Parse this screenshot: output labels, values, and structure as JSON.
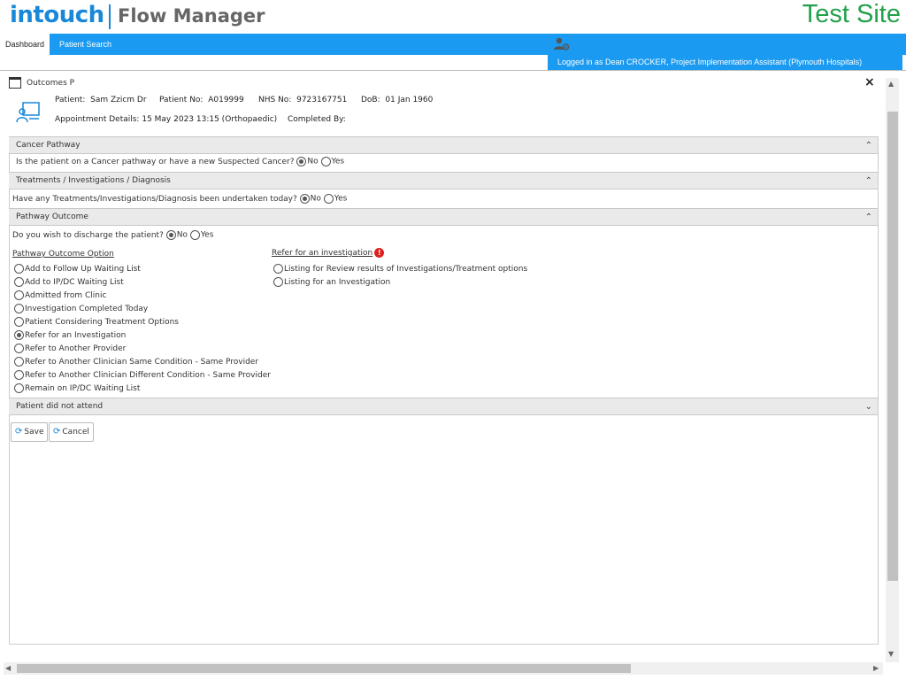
{
  "header": {
    "brand": "intouch",
    "product": "Flow Manager",
    "environment": "Test Site"
  },
  "nav": {
    "tabs": [
      "Dashboard",
      "Patient Search"
    ],
    "login_text": "Logged in as Dean CROCKER, Project Implementation Assistant (Plymouth Hospitals)"
  },
  "window": {
    "title": "Outcomes P",
    "close": "×"
  },
  "patient": {
    "patient_label": "Patient:",
    "patient_name": "Sam Zzicm Dr",
    "patient_no_label": "Patient No:",
    "patient_no": "A019999",
    "nhs_label": "NHS No:",
    "nhs_no": "9723167751",
    "dob_label": "DoB:",
    "dob": "01 Jan 1960",
    "appt_label": "Appointment Details:",
    "appt": "15 May 2023 13:15 (Orthopaedic)",
    "completed_label": "Completed By:"
  },
  "sections": {
    "cancer": {
      "title": "Cancer Pathway",
      "question": "Is the patient on a Cancer pathway or have a new Suspected Cancer?",
      "selected": "No"
    },
    "treatments": {
      "title": "Treatments / Investigations / Diagnosis",
      "question": "Have any Treatments/Investigations/Diagnosis been undertaken today?",
      "selected": "No"
    },
    "pathway": {
      "title": "Pathway Outcome",
      "question": "Do you wish to discharge the patient?",
      "selected": "No",
      "options_header": "Pathway Outcome Option",
      "options": [
        "Add to Follow Up Waiting List",
        "Add to IP/DC Waiting List",
        "Admitted from Clinic",
        "Investigation Completed Today",
        "Patient Considering Treatment Options",
        "Refer for an Investigation",
        "Refer to Another Provider",
        "Refer to Another Clinician Same Condition - Same Provider",
        "Refer to Another Clinician Different Condition - Same Provider",
        "Remain on IP/DC Waiting List"
      ],
      "selected_option": "Refer for an Investigation",
      "refer_header": "Refer for an investigation",
      "refer_options": [
        "Listing for Review results of Investigations/Treatment options",
        "Listing for an Investigation"
      ]
    },
    "dna": {
      "title": "Patient did not attend"
    }
  },
  "radio_labels": {
    "no": "No",
    "yes": "Yes"
  },
  "buttons": {
    "save": "Save",
    "cancel": "Cancel"
  },
  "colors": {
    "brand_blue": "#1a9af0",
    "test_green": "#22a14a",
    "warning_red": "#e02020"
  }
}
